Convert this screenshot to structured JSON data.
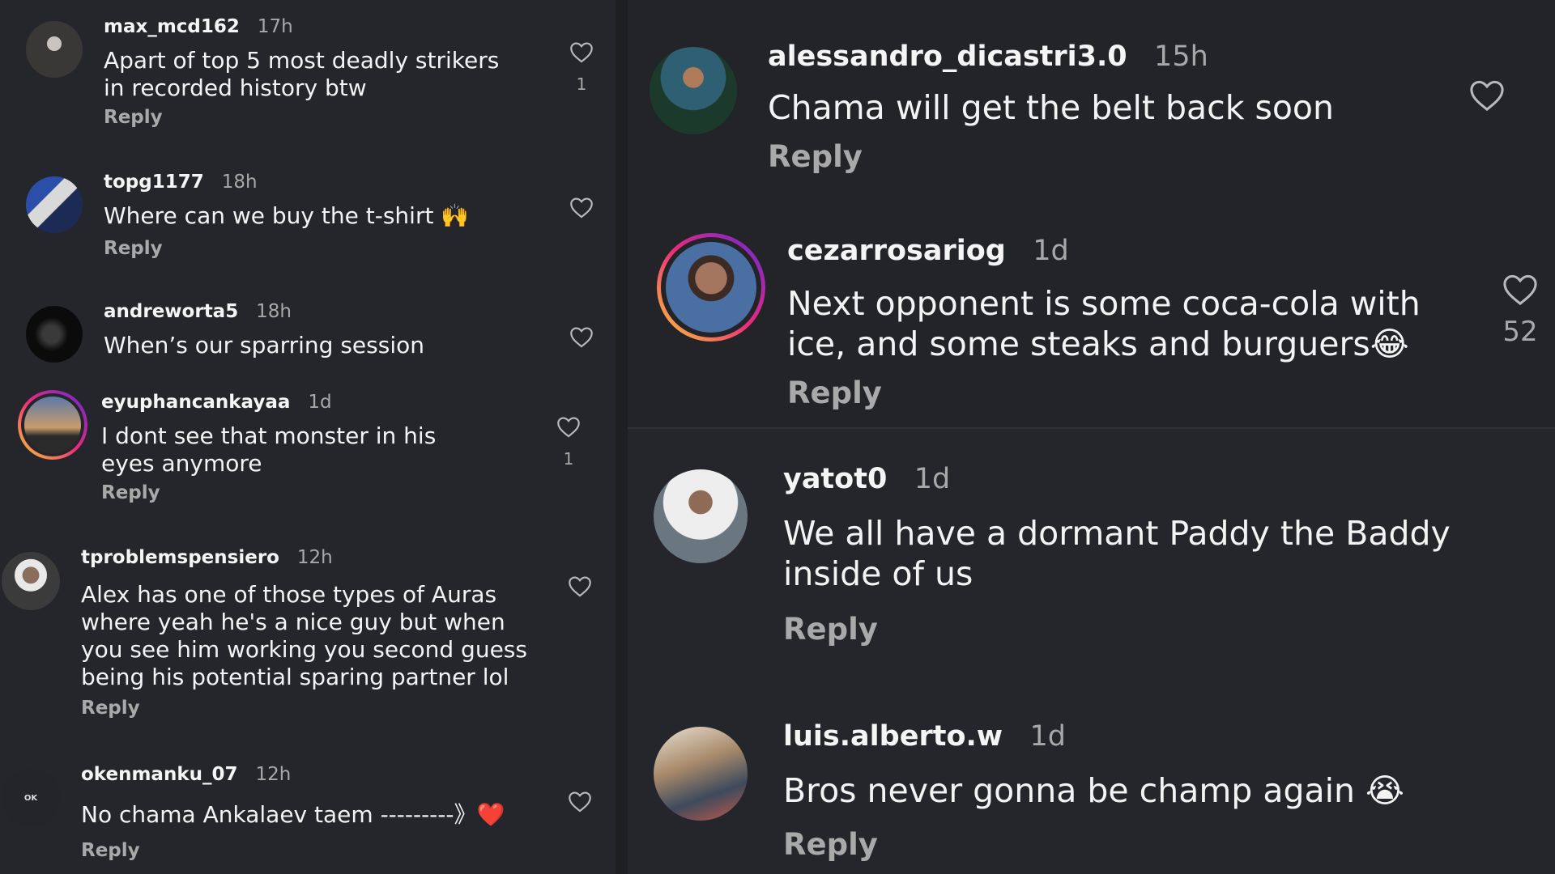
{
  "left_comments": [
    {
      "username": "max_mcd162",
      "time": "17h",
      "text": "Apart of top 5 most deadly strikers in recorded history btw",
      "reply": "Reply",
      "likes": "1",
      "avatar": "avatar-dark-figure"
    },
    {
      "username": "topg1177",
      "time": "18h",
      "text": "Where can we buy the t-shirt 🙌",
      "reply": "Reply",
      "likes": "",
      "avatar": "avatar-racing-suit"
    },
    {
      "username": "andreworta5",
      "time": "18h",
      "text": "When’s our sparring session",
      "reply": "",
      "likes": "",
      "avatar": "avatar-dark"
    },
    {
      "username": "eyuphancankayaa",
      "time": "1d",
      "text": "I dont see that monster in his eyes anymore",
      "reply": "Reply",
      "likes": "1",
      "avatar": "avatar-sunset-story-ring"
    },
    {
      "username": "tproblemspensiero",
      "time": "12h",
      "text": "Alex has one of those types of Auras where yeah he's a nice guy but when you see him working you second guess being his potential sparing partner lol",
      "reply": "Reply",
      "likes": "",
      "avatar": "avatar-person"
    },
    {
      "username": "okenmanku_07",
      "time": "12h",
      "text": "No chama Ankalaev taem ---------》❤️",
      "reply": "Reply",
      "likes": "",
      "avatar": "avatar-ok-logo",
      "avatar_label": "OK"
    }
  ],
  "right_comments": [
    {
      "username": "alessandro_dicastri3.0",
      "time": "15h",
      "text": "Chama will get the belt back soon",
      "reply": "Reply",
      "likes": "",
      "avatar": "avatar-athlete"
    },
    {
      "username": "cezarrosariog",
      "time": "1d",
      "text": "Next opponent is some coca-cola with ice, and some steaks and burguers😂",
      "reply": "Reply",
      "likes": "52",
      "avatar": "avatar-portrait-story-ring"
    },
    {
      "username": "yatot0",
      "time": "1d",
      "text": "We all have a dormant Paddy the Baddy inside of us",
      "reply": "Reply",
      "likes": "",
      "avatar": "avatar-man-white-shirt"
    },
    {
      "username": "luis.alberto.w",
      "time": "1d",
      "text": "Bros never gonna be champ again 😭",
      "reply": "Reply",
      "likes": "",
      "avatar": "avatar-indoor-photo"
    }
  ],
  "colors": {
    "background": "#25262b",
    "text": "#f3f3f3",
    "muted": "#a8a8a8",
    "story_ring_start": "#f9ce34",
    "story_ring_end": "#c13584"
  },
  "icons": {
    "like": "heart-outline-icon"
  }
}
